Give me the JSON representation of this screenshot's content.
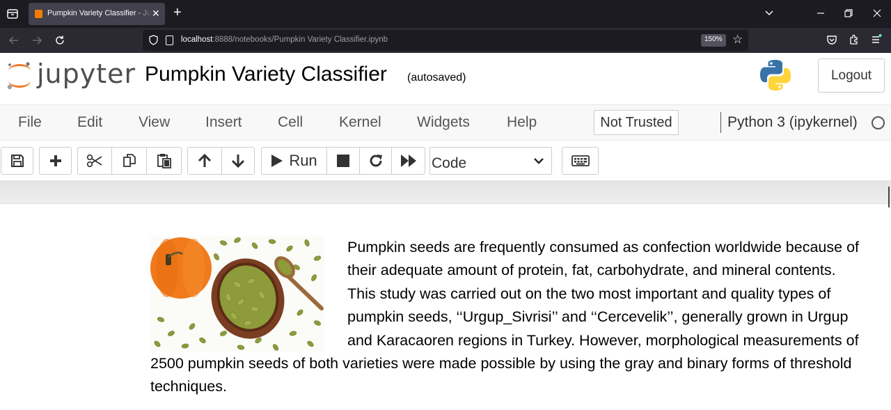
{
  "browser": {
    "tab_title": "Pumpkin Variety Classifier - Jupyter Notebook",
    "url_host": "localhost",
    "url_rest": ":8888/notebooks/Pumpkin Variety Classifier.ipynb",
    "zoom": "150%"
  },
  "header": {
    "logo_text": "jupyter",
    "notebook_name": "Pumpkin Variety Classifier",
    "save_status": "(autosaved)",
    "logout_label": "Logout"
  },
  "menubar": {
    "items": [
      "File",
      "Edit",
      "View",
      "Insert",
      "Cell",
      "Kernel",
      "Widgets",
      "Help"
    ],
    "trust_label": "Not Trusted",
    "kernel_name": "Python 3 (ipykernel)"
  },
  "toolbar": {
    "run_label": "Run",
    "cell_type": "Code"
  },
  "cell": {
    "text": "Pumpkin seeds are frequently consumed as confection worldwide because of their adequate amount of protein, fat, carbohydrate, and mineral contents. This study was carried out on the two most important and quality types of pumpkin seeds, ‘‘Urgup_Sivrisi’’ and ‘‘Cercevelik’’, generally grown in Urgup and Karacaoren regions in Turkey. However, morphological measurements of 2500 pumpkin seeds of both varieties were made possible by using the gray and binary forms of threshold techniques."
  },
  "colors": {
    "tab_bar": "#1c1b22",
    "nav_bar": "#2b2a33",
    "jupyter_orange": "#f37726",
    "menubar_bg": "#f8f8f8",
    "pumpkin": "#f07a1c",
    "seed_green": "#8d9b3a"
  }
}
